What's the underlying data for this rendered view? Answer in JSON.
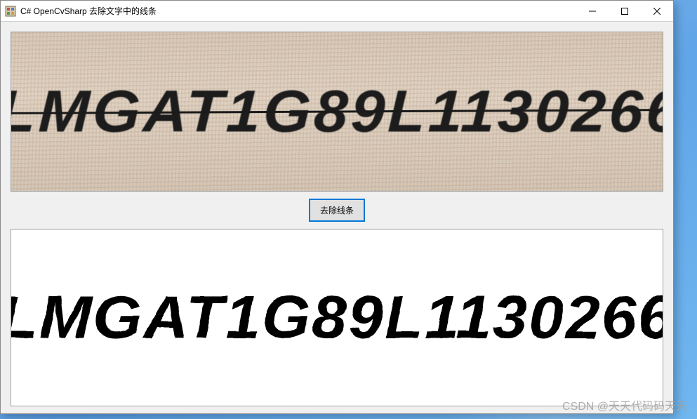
{
  "window": {
    "title": "C# OpenCvSharp 去除文字中的线条"
  },
  "button": {
    "remove_lines": "去除线条"
  },
  "source": {
    "text": "LMGAT1G89L1130266"
  },
  "output": {
    "text": "LMGAT1G89L1130266"
  },
  "watermark": "CSDN @天天代码码天天"
}
